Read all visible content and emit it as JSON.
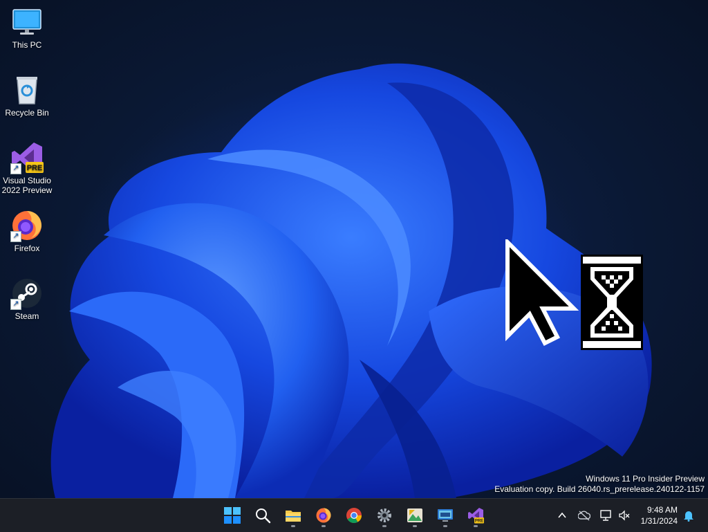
{
  "desktop": {
    "icons": [
      {
        "label": "This PC",
        "icon": "monitor-icon"
      },
      {
        "label": "Recycle Bin",
        "icon": "recycle-bin-icon"
      },
      {
        "label": "Visual Studio 2022 Preview",
        "icon": "visual-studio-icon",
        "badge": "PRE"
      },
      {
        "label": "Firefox",
        "icon": "firefox-icon"
      },
      {
        "label": "Steam",
        "icon": "steam-icon"
      }
    ],
    "watermark": {
      "line1": "Windows 11 Pro Insider Preview",
      "line2": "Evaluation copy. Build 26040.rs_prerelease.240122-1157"
    }
  },
  "taskbar": {
    "apps": [
      {
        "name": "start",
        "icon": "windows-start-icon"
      },
      {
        "name": "search",
        "icon": "search-icon"
      },
      {
        "name": "file-explorer",
        "icon": "folder-icon",
        "running": true
      },
      {
        "name": "firefox",
        "icon": "firefox-icon",
        "running": true
      },
      {
        "name": "chrome",
        "icon": "chrome-icon"
      },
      {
        "name": "settings",
        "icon": "gear-icon",
        "running": true
      },
      {
        "name": "photos",
        "icon": "photos-icon",
        "running": true
      },
      {
        "name": "remote-desktop",
        "icon": "remote-desktop-icon",
        "running": true
      },
      {
        "name": "visual-studio",
        "icon": "visual-studio-icon",
        "badge": "PRE",
        "running": true
      }
    ],
    "tray": {
      "icons": [
        "chevron-up-icon",
        "onedrive-icon",
        "network-icon",
        "volume-muted-icon",
        "notification-bell-icon"
      ],
      "time": "9:48 AM",
      "date": "1/31/2024"
    }
  },
  "colors": {
    "accent": "#1a6bff",
    "taskbar": "#1c1f26",
    "wallpaper_bloom": "#1546e0"
  }
}
